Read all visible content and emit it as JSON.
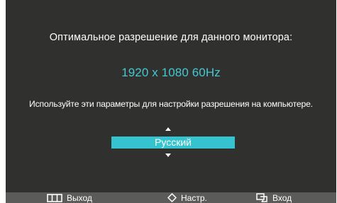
{
  "message": {
    "title": "Оптимальное разрешение для данного монитора:",
    "resolution": "1920 x 1080  60Hz",
    "hint": "Используйте эти параметры для настройки разрешения на компьютере."
  },
  "language_selector": {
    "selected": "Русский"
  },
  "bottom_bar": {
    "exit_label": "Выход",
    "adjust_label": "Настр.",
    "enter_label": "Вход"
  },
  "colors": {
    "background": "#30302f",
    "accent": "#46c8d2",
    "highlight": "#34c3cf",
    "bottom_bar": "#5b5b5a"
  },
  "icons": {
    "exit": "menu-icon",
    "adjust": "up-down-icon",
    "enter": "source-enter-icon"
  }
}
